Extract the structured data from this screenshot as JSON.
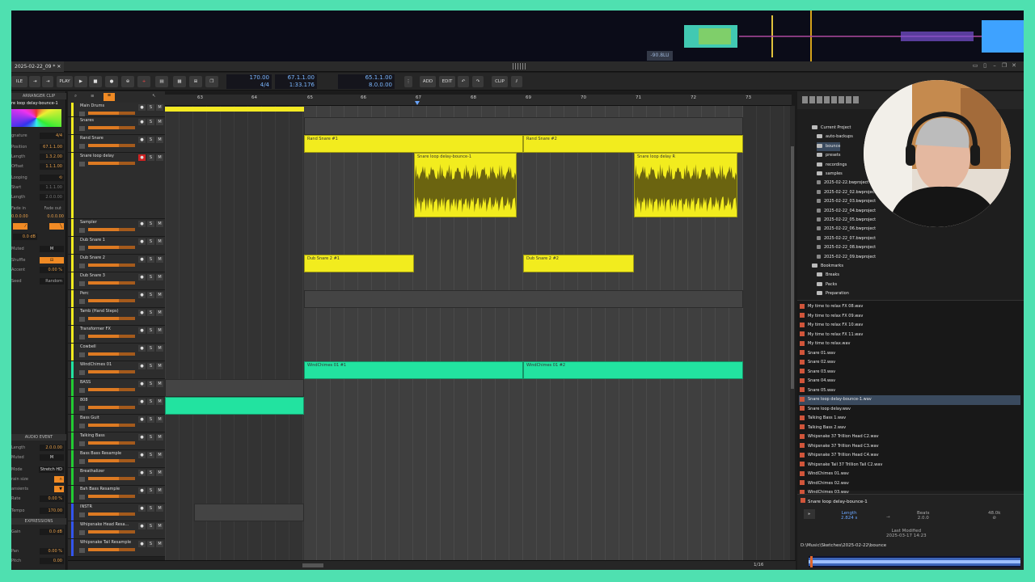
{
  "titlebar": {
    "tab": "2025-02-22_09 *"
  },
  "level_readout": "-90.8LU",
  "transport": {
    "play": "PLAY",
    "bpm": "170.00",
    "meter": "4/4",
    "position": "67.1.1.00",
    "time": "1:33.176",
    "loop_start": "65.1.1.00",
    "loop_length": "8.0.0.00",
    "add": "ADD",
    "edit": "EDIT",
    "clip": "CLIP"
  },
  "inspector": {
    "header": "ARRANGER CLIP",
    "clip_name": "re loop delay-bounce-1",
    "signature_label": "gnature",
    "signature": "4/4",
    "position_label": "Position",
    "position": "67.1.1.00",
    "length_label": "Length",
    "length": "1.3.2.00",
    "offset_label": "Offset",
    "offset": "1.1.1.00",
    "looping_label": "Looping",
    "start_label": "Start",
    "start": "1.1.1.00",
    "loop_length_label": "Length",
    "loop_length": "2.0.0.00",
    "fade_in_label": "Fade in",
    "fade_out_label": "Fade out",
    "fade_in": "0.0.0.00",
    "fade_out": "0.0.0.00",
    "gain": "0.0 dB",
    "muted_label": "Muted",
    "shuffle_label": "Shuffle",
    "accent_label": "Accent",
    "accent": "0.00 %",
    "seed_label": "Seed",
    "seed": "Random",
    "audio_header": "AUDIO EVENT",
    "ae_length_label": "Length",
    "ae_length": "2.0.0.00",
    "ae_muted_label": "Muted",
    "mode_label": "Mode",
    "mode": "Stretch HD",
    "grain_label": "rain size",
    "transients_label": "ansients",
    "rate_label": "Rate",
    "rate": "0.00 %",
    "tempo_label": "Tempo",
    "tempo": "170.00",
    "expr_header": "EXPRESSIONS",
    "gain_label": "Gain",
    "expr_gain": "0.0 dB",
    "pan_label": "Pan",
    "pan": "0.00 %",
    "pitch_label": "Pitch",
    "pitch": "0.00"
  },
  "tracks": [
    {
      "name": "Main Drums",
      "color": "#f2ec1e"
    },
    {
      "name": "Snares",
      "color": "#f2ec1e"
    },
    {
      "name": "Rand Snare",
      "color": "#f2ec1e"
    },
    {
      "name": "Snare loop delay",
      "color": "#f2ec1e"
    },
    {
      "name": "Sampler",
      "color": "#f2ec1e"
    },
    {
      "name": "Dub Snare 1",
      "color": "#f2ec1e"
    },
    {
      "name": "Dub Snare 2",
      "color": "#f2ec1e"
    },
    {
      "name": "Dub Snare 3",
      "color": "#f2ec1e"
    },
    {
      "name": "Perc",
      "color": "#f2ec1e"
    },
    {
      "name": "Tamb (Hand Steps)",
      "color": "#f2ec1e"
    },
    {
      "name": "Transformer FX",
      "color": "#f2ec1e"
    },
    {
      "name": "Cowbell",
      "color": "#f2ec1e"
    },
    {
      "name": "WindChimes 01",
      "color": "#22e3a0"
    },
    {
      "name": "BASS",
      "color": "#22cc33"
    },
    {
      "name": "808",
      "color": "#22cc33"
    },
    {
      "name": "Bass Guit",
      "color": "#22cc33"
    },
    {
      "name": "Talking Bass",
      "color": "#22cc33"
    },
    {
      "name": "Bass Bass Resample",
      "color": "#22cc33"
    },
    {
      "name": "Breathalizer",
      "color": "#22cc33"
    },
    {
      "name": "Bah Bass Resample",
      "color": "#22cc33"
    },
    {
      "name": "INSTR",
      "color": "#3355ee"
    },
    {
      "name": "Whipsnake Head Resa...",
      "color": "#3355ee"
    },
    {
      "name": "Whipsnake Tail Resample",
      "color": "#3355ee"
    }
  ],
  "ruler": {
    "bars": [
      "63",
      "64",
      "65",
      "67",
      "66",
      "68",
      "69",
      "70",
      "71",
      "72",
      "73"
    ]
  },
  "clips": {
    "rand1": "Rand Snare #1",
    "rand2": "Rand Snare #2",
    "loop1": "Snare loop delay-bounce-1",
    "loop2": "Snare loop delay R",
    "dub1": "Dub Snare 2 #1",
    "dub2": "Dub Snare 2 #2",
    "wind1": "WindChimes 01 #1",
    "wind2": "WindChimes 01 #2"
  },
  "footer": {
    "quant": "1/16"
  },
  "browser": {
    "section1": "Current Project",
    "folders": [
      "auto-backups",
      "bounce",
      "presets",
      "recordings",
      "samples"
    ],
    "projects": [
      "2025-02-22.bwproject",
      "2025-02-22_02.bwproject",
      "2025-02-22_03.bwproject",
      "2025-02-22_04.bwproject",
      "2025-02-22_05.bwproject",
      "2025-02-22_06.bwproject",
      "2025-02-22_07.bwproject",
      "2025-02-22_08.bwproject",
      "2025-02-22_09.bwproject"
    ],
    "section2": "Bookmarks",
    "bookmarks": [
      "Breaks",
      "Packs",
      "Preparation"
    ],
    "files": [
      "My time to relax FX 08.wav",
      "My time to relax FX 09.wav",
      "My time to relax FX 10.wav",
      "My time to relax FX 11.wav",
      "My time to relax.wav",
      "Snare 01.wav",
      "Snare 02.wav",
      "Snare 03.wav",
      "Snare 04.wav",
      "Snare 05.wav",
      "Snare loop delay-bounce-1.wav",
      "Snare loop delay.wav",
      "Talking Bass 1.wav",
      "Talking Bass 2.wav",
      "Whipsnake 37 Trillion Head C2.wav",
      "Whipsnake 37 Trillion Head C3.wav",
      "Whipsnake 37 Trillion Head C4.wav",
      "Whipsnake Tail 37 Trillion Tail C2.wav",
      "WindChimes 01.wav",
      "WindChimes 02.wav",
      "WindChimes 03.wav"
    ],
    "preview": {
      "name": "Snare loop delay-bounce-1",
      "length_label": "Length",
      "length": "2.824 s",
      "beats_label": "Beats",
      "beats": "2.0.0",
      "rate": "48.0k",
      "modified_label": "Last Modified",
      "modified": "2025-03-17 14:23",
      "path": "D:\\Music\\Sketches\\2025-02-22\\bounce"
    }
  },
  "colors": {
    "clip_yellow": "#f2ec1e",
    "clip_green": "#22e3a0",
    "accent_orange": "#f08a24"
  }
}
